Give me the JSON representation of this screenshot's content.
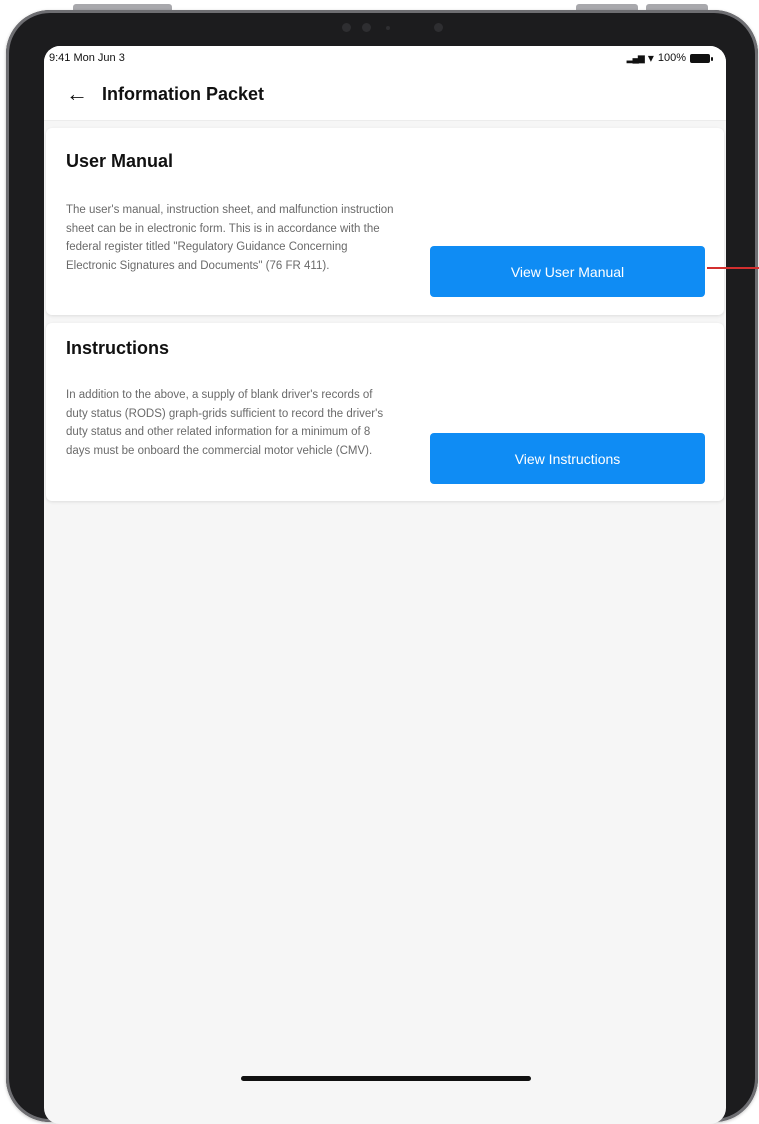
{
  "status_bar": {
    "time": "9:41 Mon Jun 3",
    "signal": "▂▄▆",
    "wifi": "▾",
    "battery": "100%"
  },
  "header": {
    "back_icon": "←",
    "title": "Information Packet"
  },
  "sections": [
    {
      "title": "User Manual",
      "description": "The user's manual, instruction sheet, and malfunction instruction sheet can be in electronic form. This is in accordance with the federal register titled \"Regulatory Guidance Concerning Electronic Signatures and Documents\" (76 FR 411).",
      "button_label": "View User Manual"
    },
    {
      "title": "Instructions",
      "description": "In addition to the above, a supply of blank driver's records of duty status (RODS) graph-grids sufficient to record the driver's duty status and other related information for a minimum of 8 days must be onboard the commercial motor vehicle (CMV).",
      "button_label": "View Instructions"
    }
  ],
  "colors": {
    "accent": "#0f8cf4",
    "pointer": "#d32f2f",
    "background": "#f6f6f6"
  },
  "icons": [
    "back-arrow-icon",
    "signal-icon",
    "wifi-icon",
    "battery-icon"
  ]
}
